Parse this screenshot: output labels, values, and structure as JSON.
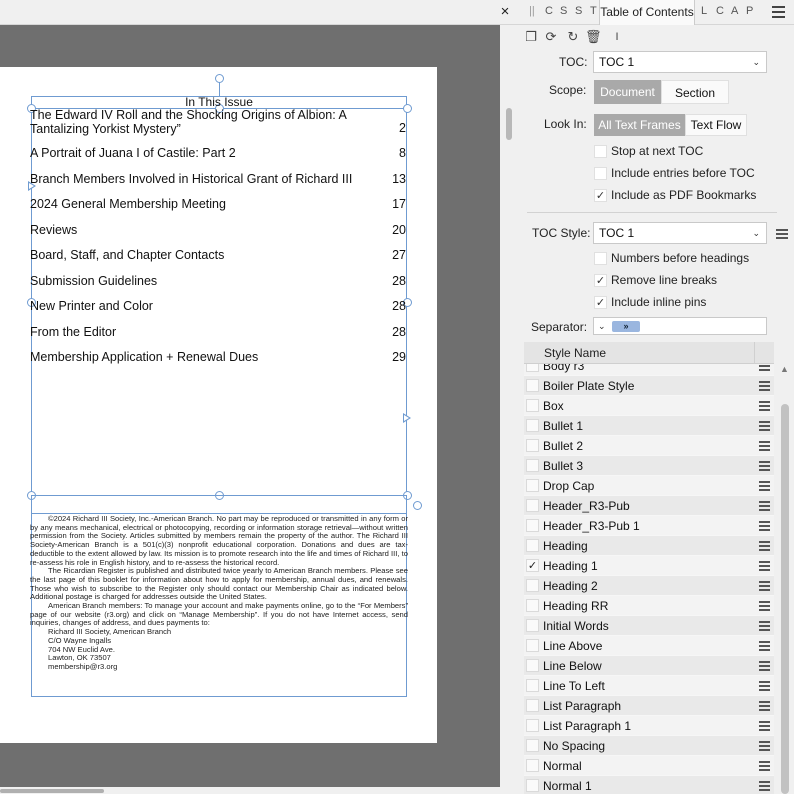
{
  "canvas": {
    "close_glyph": "×",
    "toc_title": "In This Issue",
    "toc_entries": [
      {
        "title_line1": "The Edward IV Roll and the Shocking Origins of Albion: A",
        "title_line2": "Tantalizing Yorkist Mystery”",
        "page": "2"
      },
      {
        "title": "A Portrait of Juana I of Castile: Part 2",
        "page": "8"
      },
      {
        "title": "Branch Members Involved in Historical Grant of Richard III",
        "page": "13"
      },
      {
        "title": "2024 General Membership Meeting",
        "page": "17"
      },
      {
        "title": "Reviews",
        "page": "20"
      },
      {
        "title": "Board, Staff, and Chapter Contacts",
        "page": "27"
      },
      {
        "title": "Submission Guidelines",
        "page": "28"
      },
      {
        "title": "New Printer and Color",
        "page": "28"
      },
      {
        "title": "From the Editor",
        "page": "28"
      },
      {
        "title": "Membership Application + Renewal Dues",
        "page": "29"
      }
    ],
    "footer": {
      "para1": "©2024 Richard III Society, Inc.-American Branch. No part may be reproduced or transmitted in any form or by any means mechanical, electrical or photocopying, recording or information storage retrieval—without written permission from the Society. Articles submitted by members remain the property of the author. The Richard III Society-American Branch is a 501(c)(3) nonprofit educational corporation. Donations and dues are tax-deductible to the extent allowed by law. Its mission is to promote research into the life and times of Richard III, to re-assess his role in English history, and to re-assess the historical record.",
      "para2": "The Ricardian Register is published and distributed twice yearly to American Branch members. Please see the last page of this booklet for information about how to apply for membership, annual dues, and renewals. Those who wish to subscribe to the Register only should contact our Membership Chair as indicated below. Additional postage is charged for addresses outside the United States.",
      "para3": "American Branch members: To manage your account and make payments online, go to the “For Members” page of our website (r3.org) and click on “Manage Membership”. If you do not have Internet access, send inquiries, changes of address, and dues payments to:",
      "addr1": "Richard III Society, American Branch",
      "addr2": "C/O Wayne Ingalls",
      "addr3": "704 NW Euclid Ave.",
      "addr4": "Lawton, OK 73507",
      "addr5": "membership@r3.org"
    }
  },
  "panel": {
    "tabs_left": [
      "C",
      "S",
      "S",
      "T"
    ],
    "active_tab": "Table of Contents",
    "tabs_right": [
      "L",
      "C",
      "A",
      "P"
    ],
    "toolbar_icons": [
      "copy-icon",
      "update-icon",
      "refresh-icon",
      "delete-icon",
      "text-cursor-icon"
    ],
    "toc_label": "TOC:",
    "toc_value": "TOC 1",
    "scope_label": "Scope:",
    "scope_options": [
      "Document",
      "Section"
    ],
    "lookin_label": "Look In:",
    "lookin_options": [
      "All Text Frames",
      "Text Flow"
    ],
    "options": [
      {
        "label": "Stop at next TOC",
        "checked": false
      },
      {
        "label": "Include entries before TOC",
        "checked": false
      },
      {
        "label": "Include as PDF Bookmarks",
        "checked": true
      }
    ],
    "toc_style_label": "TOC Style:",
    "toc_style_value": "TOC 1",
    "style_options": [
      {
        "label": "Numbers before headings",
        "checked": false
      },
      {
        "label": "Remove line breaks",
        "checked": true
      },
      {
        "label": "Include inline pins",
        "checked": true
      }
    ],
    "separator_label": "Separator:",
    "separator_value": "»",
    "style_list_header": "Style Name",
    "styles": [
      {
        "name": "Body r3",
        "checked": false
      },
      {
        "name": "Boiler Plate Style",
        "checked": false
      },
      {
        "name": "Box",
        "checked": false
      },
      {
        "name": "Bullet 1",
        "checked": false
      },
      {
        "name": "Bullet 2",
        "checked": false
      },
      {
        "name": "Bullet 3",
        "checked": false
      },
      {
        "name": "Drop Cap",
        "checked": false
      },
      {
        "name": "Header_R3-Pub",
        "checked": false
      },
      {
        "name": "Header_R3-Pub 1",
        "checked": false
      },
      {
        "name": "Heading",
        "checked": false
      },
      {
        "name": "Heading 1",
        "checked": true
      },
      {
        "name": "Heading 2",
        "checked": false
      },
      {
        "name": "Heading RR",
        "checked": false
      },
      {
        "name": "Initial Words",
        "checked": false
      },
      {
        "name": "Line Above",
        "checked": false
      },
      {
        "name": "Line Below",
        "checked": false
      },
      {
        "name": "Line To Left",
        "checked": false
      },
      {
        "name": "List Paragraph",
        "checked": false
      },
      {
        "name": "List Paragraph 1",
        "checked": false
      },
      {
        "name": "No Spacing",
        "checked": false
      },
      {
        "name": "Normal",
        "checked": false
      },
      {
        "name": "Normal 1",
        "checked": false
      }
    ],
    "colors": {
      "selection": "#6f9bd1",
      "segment_active": "#a9a9a9",
      "separator_chip": "#9ab6df"
    }
  }
}
